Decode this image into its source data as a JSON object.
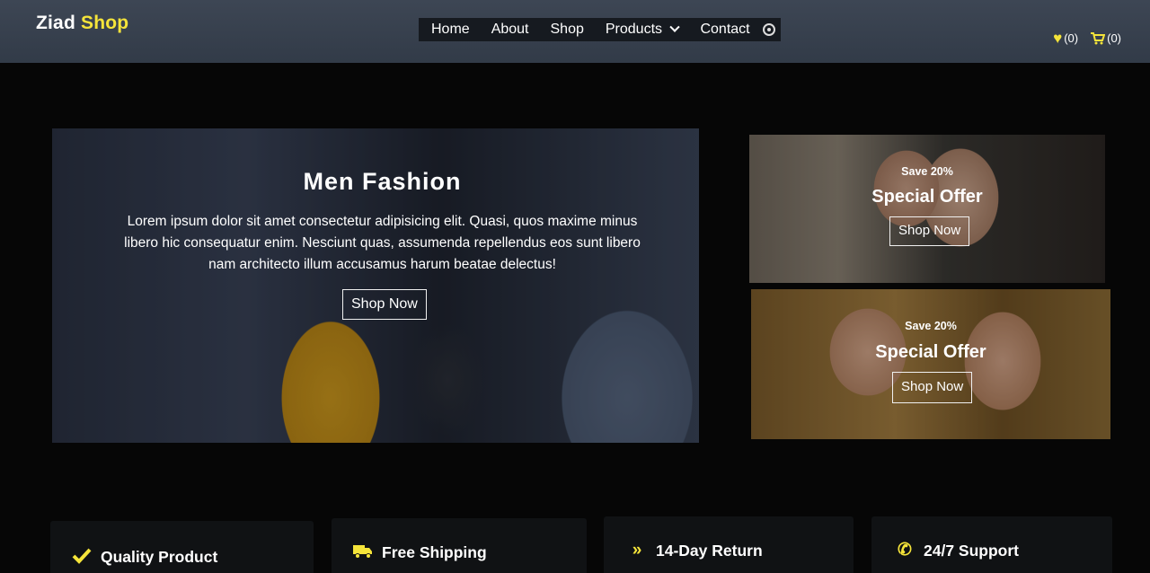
{
  "brand": {
    "part1": "Ziad",
    "part2": "Shop",
    "accent_color": "#f5e43a"
  },
  "nav": {
    "links": [
      "Home",
      "About",
      "Shop",
      "Products",
      "Contact"
    ],
    "products_icon": "chevron-down-icon",
    "extra_icon": "circle-icon"
  },
  "header_actions": {
    "wishlist_count": "(0)",
    "cart_count": "(0)",
    "wishlist_icon": "heart-icon",
    "cart_icon": "cart-icon"
  },
  "hero": {
    "title": "Men Fashion",
    "text": "Lorem ipsum dolor sit amet consectetur adipisicing elit. Quasi, quos maxime minus libero hic consequatur enim. Nesciunt quas, assumenda repellendus eos sunt libero nam architecto illum accusamus harum beatae delectus!",
    "button": "Shop Now"
  },
  "offers": [
    {
      "small": "Save 20%",
      "big": "Special Offer",
      "button": "Shop Now"
    },
    {
      "small": "Save 20%",
      "big": "Special Offer",
      "button": "Shop Now"
    }
  ],
  "features": [
    {
      "icon": "check-icon",
      "label": "Quality Product"
    },
    {
      "icon": "truck-icon",
      "label": "Free Shipping"
    },
    {
      "icon": "double-chevron-icon",
      "label": "14-Day Return"
    },
    {
      "icon": "phone-icon",
      "label": "24/7 Support"
    }
  ]
}
